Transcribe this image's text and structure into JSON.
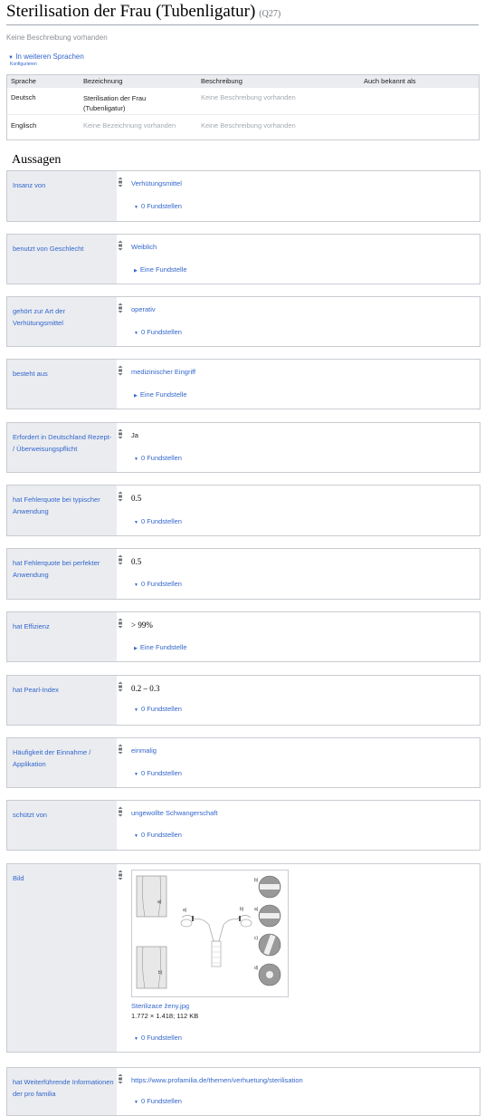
{
  "header": {
    "title": "Sterilisation der Frau (Tubenligatur)",
    "qid": "(Q27)"
  },
  "description": "Keine Beschreibung vorhanden",
  "languages": {
    "toggle_label": "In weiteren Sprachen",
    "configure_label": "Konfigurieren",
    "columns": [
      "Sprache",
      "Bezeichnung",
      "Beschreibung",
      "Auch bekannt als"
    ],
    "rows": [
      {
        "language": "Deutsch",
        "label": "Sterilisation der Frau (Tubenligatur)",
        "description": "Keine Beschreibung vorhanden",
        "aliases": ""
      },
      {
        "language": "Englisch",
        "label": "Keine Bezeichnung vorhanden",
        "description": "Keine Beschreibung vorhanden",
        "aliases": ""
      }
    ]
  },
  "statements_heading": "Aussagen",
  "statements": [
    {
      "property": "Insanz von",
      "value": "Verhütungsmittel",
      "refs": "0 Fundstellen"
    },
    {
      "property": "benutzt von Geschlecht",
      "value": "Weiblich",
      "refs": "Eine Fundstelle"
    },
    {
      "property": "gehört zur Art der Verhütungsmittel",
      "value": "operativ",
      "refs": "0 Fundstellen"
    },
    {
      "property": "besteht aus",
      "value": "medizinischer Eingriff",
      "refs": "Eine Fundstelle"
    },
    {
      "property": "Erfordert in Deutschland Rezept- / Überweisungspflicht",
      "value": "Ja",
      "refs": "0 Fundstellen"
    },
    {
      "property": "hat Fehlerquote bei typischer Anwendung",
      "value": "0.5",
      "refs": "0 Fundstellen"
    },
    {
      "property": "hat Fehlerquote bei perfekter Anwendung",
      "value": "0.5",
      "refs": "0 Fundstellen"
    },
    {
      "property": "hat Effizienz",
      "value": "> 99%",
      "refs": "Eine Fundstelle"
    },
    {
      "property": "hat Pearl-Index",
      "value": "0.2 – 0.3",
      "refs": "0 Fundstellen"
    },
    {
      "property": "Häufigkeit der Einnahme / Applikation",
      "value": "einmalig",
      "refs": "0 Fundstellen"
    },
    {
      "property": "schützt von",
      "value": "ungewollte Schwangerschaft",
      "refs": "0 Fundstellen"
    },
    {
      "property": "Bild",
      "file_name": "Sterilizace ženy.jpg",
      "file_info": "1.772 × 1.418; 112 KB",
      "refs": "0 Fundstellen",
      "figure_labels": {
        "a": "a)",
        "b": "b)"
      }
    },
    {
      "property": "hat Weiterführende Informationen der pro familia",
      "value": "https://www.profamilia.de/themen/verhuetung/sterilisation",
      "refs": "0 Fundstellen"
    }
  ],
  "colors": {
    "link": "#3366cc",
    "label_bg": "#eaecf0",
    "border": "#c8ccd1",
    "muted": "#a2a9b1"
  }
}
